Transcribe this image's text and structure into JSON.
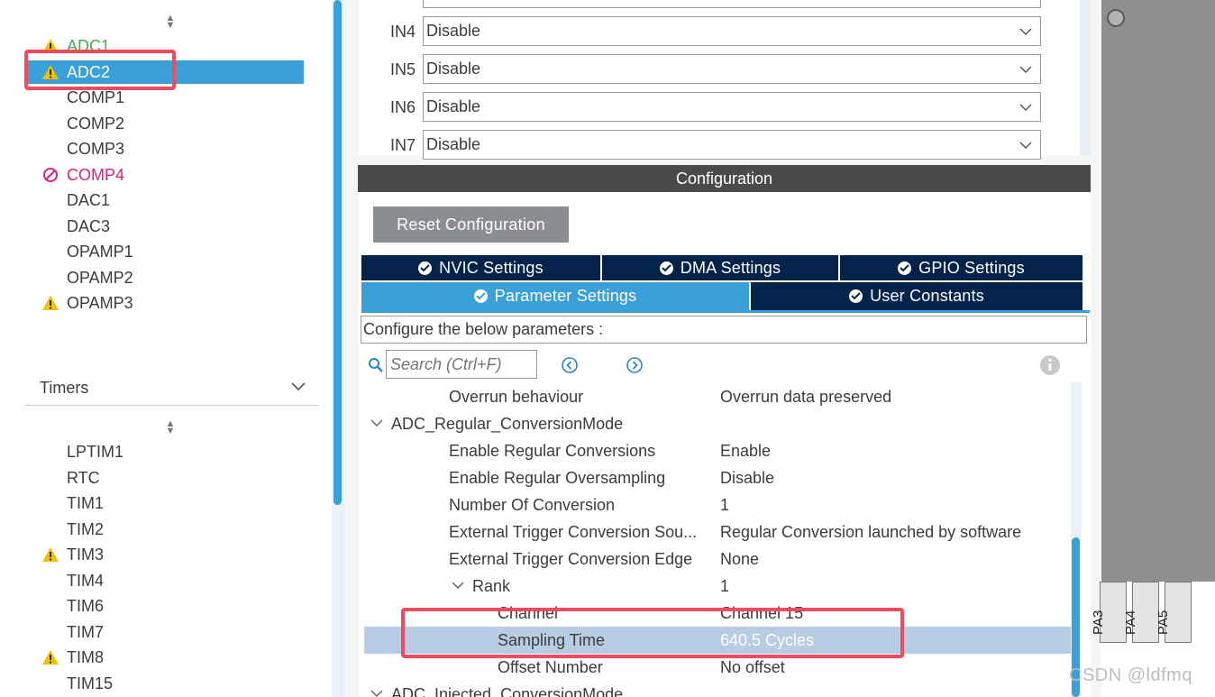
{
  "left_panel": {
    "analog_items": [
      {
        "label": "ADC1",
        "status": "warning"
      },
      {
        "label": "ADC2",
        "status": "warning",
        "selected": true
      },
      {
        "label": "COMP1",
        "status": "none"
      },
      {
        "label": "COMP2",
        "status": "none"
      },
      {
        "label": "COMP3",
        "status": "none"
      },
      {
        "label": "COMP4",
        "status": "error"
      },
      {
        "label": "DAC1",
        "status": "none"
      },
      {
        "label": "DAC3",
        "status": "none"
      },
      {
        "label": "OPAMP1",
        "status": "none"
      },
      {
        "label": "OPAMP2",
        "status": "none"
      },
      {
        "label": "OPAMP3",
        "status": "warning"
      }
    ],
    "timers_header": "Timers",
    "timer_items": [
      {
        "label": "LPTIM1",
        "status": "none"
      },
      {
        "label": "RTC",
        "status": "none"
      },
      {
        "label": "TIM1",
        "status": "none"
      },
      {
        "label": "TIM2",
        "status": "none"
      },
      {
        "label": "TIM3",
        "status": "warning"
      },
      {
        "label": "TIM4",
        "status": "none"
      },
      {
        "label": "TIM6",
        "status": "none"
      },
      {
        "label": "TIM7",
        "status": "none"
      },
      {
        "label": "TIM8",
        "status": "warning"
      },
      {
        "label": "TIM15",
        "status": "none"
      }
    ]
  },
  "mode": {
    "inputs": [
      {
        "label": "IN4",
        "value": "Disable"
      },
      {
        "label": "IN5",
        "value": "Disable"
      },
      {
        "label": "IN6",
        "value": "Disable"
      },
      {
        "label": "IN7",
        "value": "Disable"
      }
    ]
  },
  "configuration": {
    "header": "Configuration",
    "reset_label": "Reset Configuration",
    "tabs_row1": [
      "NVIC Settings",
      "DMA Settings",
      "GPIO Settings"
    ],
    "tabs_row2": [
      "Parameter Settings",
      "User Constants"
    ],
    "active_tab": "Parameter Settings",
    "configure_text": "Configure the below parameters :",
    "search_placeholder": "Search (Ctrl+F)"
  },
  "parameters": [
    {
      "name": "Overrun behaviour",
      "value": "Overrun data preserved",
      "indent": 3
    },
    {
      "name": "ADC_Regular_ConversionMode",
      "value": "",
      "indent": 1,
      "expanded": true
    },
    {
      "name": "Enable Regular Conversions",
      "value": "Enable",
      "indent": 3
    },
    {
      "name": "Enable Regular Oversampling",
      "value": "Disable",
      "indent": 3
    },
    {
      "name": "Number Of Conversion",
      "value": "1",
      "indent": 3
    },
    {
      "name": "External Trigger Conversion Sou...",
      "value": "Regular Conversion launched by software",
      "indent": 3
    },
    {
      "name": "External Trigger Conversion Edge",
      "value": "None",
      "indent": 3
    },
    {
      "name": "Rank",
      "value": "1",
      "indent": 4,
      "expanded": true
    },
    {
      "name": "Channel",
      "value": "Channel 15",
      "indent": 5
    },
    {
      "name": "Sampling Time",
      "value": "640.5 Cycles",
      "indent": 5,
      "selected": true
    },
    {
      "name": "Offset Number",
      "value": "No offset",
      "indent": 5
    },
    {
      "name": "ADC_Injected_ConversionMode",
      "value": "",
      "indent": 1,
      "expanded": true
    }
  ],
  "chip": {
    "pins": [
      "PA3",
      "PA4",
      "PA5"
    ]
  },
  "watermark": "CSDN @ldfmq",
  "colors": {
    "accent": "#39a1d8",
    "tab_dark": "#03234b",
    "warning": "#f2c200",
    "error": "#e0207a",
    "highlight_box": "#ef4a5e"
  }
}
